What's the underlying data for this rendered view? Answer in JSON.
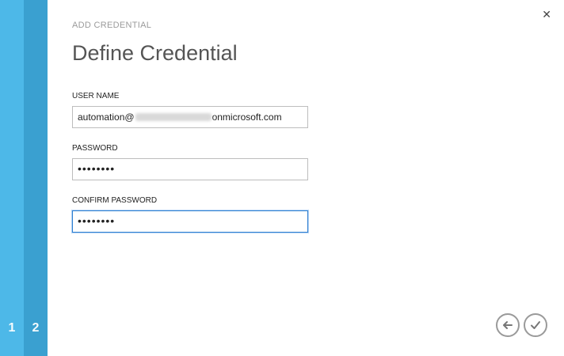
{
  "steps": [
    "1",
    "2"
  ],
  "dialog": {
    "eyebrow": "ADD CREDENTIAL",
    "title": "Define Credential",
    "close_icon": "close-icon"
  },
  "fields": {
    "username": {
      "label": "USER NAME",
      "value_prefix": "automation@",
      "value_suffix": "onmicrosoft.com"
    },
    "password": {
      "label": "PASSWORD",
      "value": "••••••••"
    },
    "confirm_password": {
      "label": "CONFIRM PASSWORD",
      "value": "••••••••"
    }
  },
  "footer": {
    "back_icon": "back-arrow-icon",
    "complete_icon": "checkmark-icon"
  },
  "colors": {
    "rail_step1": "#4db8e8",
    "rail_step2": "#3aa0d0",
    "focus_border": "#2f7fd1"
  }
}
